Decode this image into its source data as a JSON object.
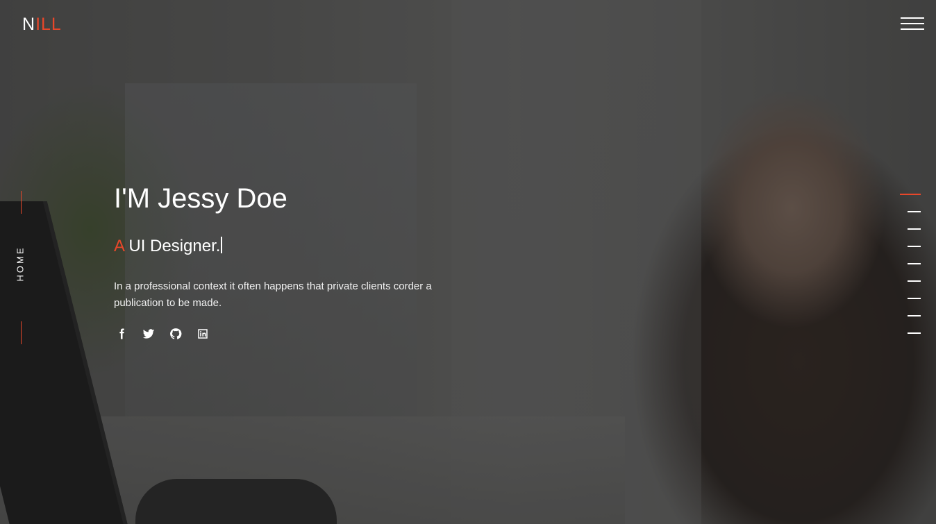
{
  "brand": {
    "logo_first": "N",
    "logo_rest": "ILL",
    "accent_color": "#e8472a"
  },
  "nav": {
    "menu_icon": "hamburger-icon"
  },
  "side": {
    "section_label": "HOME"
  },
  "hero": {
    "title": "I'M Jessy Doe",
    "subtitle_accent": "A",
    "subtitle_text": " UI Designer.",
    "description": "In a professional context it often happens that private clients corder a publication to be made."
  },
  "socials": [
    {
      "icon": "facebook-icon"
    },
    {
      "icon": "twitter-icon"
    },
    {
      "icon": "github-icon"
    },
    {
      "icon": "linkedin-icon"
    }
  ],
  "page_indicator": {
    "total": 9,
    "active": 1
  }
}
